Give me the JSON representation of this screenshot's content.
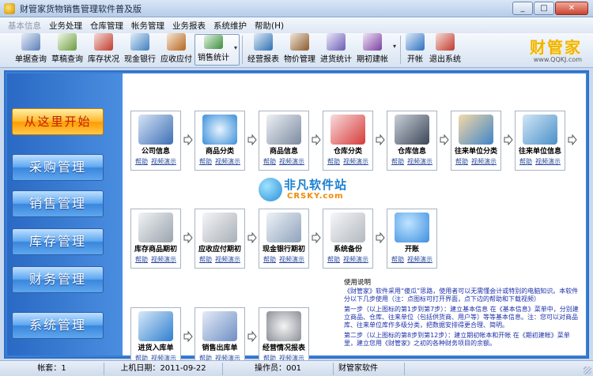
{
  "window": {
    "title": "财管家货物销售管理软件普及版"
  },
  "menu": [
    "基本信息",
    "业务处理",
    "仓库管理",
    "帐务管理",
    "业务报表",
    "系统维护",
    "帮助(H)"
  ],
  "toolbar": [
    {
      "label": "单据查询",
      "icon": "search-document-icon",
      "color": "#5a7fb8"
    },
    {
      "label": "草稿查询",
      "icon": "search-draft-icon",
      "color": "#6a9c3e"
    },
    {
      "label": "库存状况",
      "icon": "warehouse-icon",
      "color": "#c0392b"
    },
    {
      "label": "现金银行",
      "icon": "cash-bank-icon",
      "color": "#3e7fbf"
    },
    {
      "label": "应收应付",
      "icon": "receivable-icon",
      "color": "#b5651d"
    },
    {
      "label": "销售统计",
      "icon": "chart-icon",
      "color": "#3c8d3c"
    },
    {
      "label": "经营报表",
      "icon": "report-icon",
      "color": "#2c6fb0"
    },
    {
      "label": "物价管理",
      "icon": "price-book-icon",
      "color": "#8b5a2b"
    },
    {
      "label": "进货统计",
      "icon": "purchase-stats-icon",
      "color": "#6b5bb5"
    },
    {
      "label": "期初建帐",
      "icon": "opening-account-icon",
      "color": "#7a3fa0"
    },
    {
      "label": "开帐",
      "icon": "open-account-icon",
      "color": "#2a6fc0"
    },
    {
      "label": "退出系统",
      "icon": "exit-icon",
      "color": "#c0392b"
    }
  ],
  "brand": {
    "name": "财管家",
    "url": "www.QQKJ.com"
  },
  "sidebar": [
    "从这里开始",
    "采购管理",
    "销售管理",
    "库存管理",
    "财务管理",
    "系统管理"
  ],
  "links": {
    "help": "帮助",
    "video": "视频演示"
  },
  "cards_row1": [
    {
      "name": "公司信息",
      "icon": "company-house-icon",
      "color": "#3e6fb5"
    },
    {
      "name": "商品分类",
      "icon": "product-category-icon",
      "color": "#3a8fd9"
    },
    {
      "name": "商品信息",
      "icon": "product-info-gear-icon",
      "color": "#7c8aa0"
    },
    {
      "name": "仓库分类",
      "icon": "warehouse-category-icon",
      "color": "#d63a3a"
    },
    {
      "name": "仓库信息",
      "icon": "warehouse-info-icon",
      "color": "#3c4656"
    },
    {
      "name": "往来单位分类",
      "icon": "partner-category-icon",
      "color": "#3f85c9"
    },
    {
      "name": "往来单位信息",
      "icon": "partner-info-icon",
      "color": "#4a90c8"
    }
  ],
  "cards_row2": [
    {
      "name": "库存商品期初",
      "icon": "opening-stock-icon",
      "color": "#9aa3ad"
    },
    {
      "name": "应收应付期初",
      "icon": "opening-receivable-icon",
      "color": "#a9b0b8"
    },
    {
      "name": "现金银行期初",
      "icon": "opening-cash-icon",
      "color": "#8fa3bb"
    },
    {
      "name": "系统备份",
      "icon": "backup-usb-icon",
      "color": "#b3b9c0"
    },
    {
      "name": "开账",
      "icon": "open-globe-icon",
      "color": "#3d8fe0"
    }
  ],
  "cards_row3": [
    {
      "name": "进货入库单",
      "icon": "purchase-in-icon",
      "color": "#2f7fd0"
    },
    {
      "name": "销售出库单",
      "icon": "sales-out-icon",
      "color": "#6f8fc5"
    },
    {
      "name": "经营情况报表",
      "icon": "business-report-icon",
      "color": "#8a8f96"
    }
  ],
  "help_text": {
    "title": "使用说明",
    "p1": "《财管家》软件采用“傻瓜”思路，使用者可以无需懂会计或特别的电脑知识。本软件分以下几步使用（注：点图标可打开界面，点下边的帮助和下载视频）",
    "p2": "第一步（以上图标的第1步到第7步）：建立基本信息 在《基本信息》菜单中，分别建立商品、仓库、往来单位（包括供货商、用户等）等等基本信息。注：您可以对商品库、往来单位库作多级分类，把数据安排得更合理、简明。",
    "p3": "第二步（以上图标的第8步到第12步）：建立期初帐本和开帐 在《期初建帐》菜单里，建立您用《财管家》之初的各种财务项目的余额。"
  },
  "status": {
    "account_label": "帐套：",
    "account": "1",
    "last_login_label": "上机日期：",
    "last_login": "2011-09-22",
    "operator_label": "操作员：",
    "operator": "001",
    "product": "财管家软件"
  },
  "watermark": {
    "line1": "非凡软件站",
    "line2": "CRSKY.com"
  }
}
